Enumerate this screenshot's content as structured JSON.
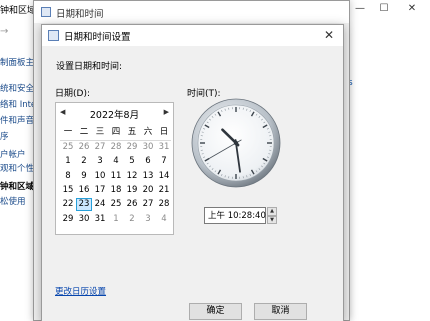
{
  "background": {
    "window_title": "钟和区域",
    "sidebar_items": [
      {
        "label": "制面板主",
        "active": false
      },
      {
        "label": "统和安全",
        "active": false
      },
      {
        "label": "络和 Inte",
        "active": false
      },
      {
        "label": "件和声音",
        "active": false
      },
      {
        "label": "序",
        "active": false
      },
      {
        "label": "户帐户",
        "active": false
      },
      {
        "label": "观和个性",
        "active": false
      },
      {
        "label": "钟和区域",
        "active": true
      },
      {
        "label": "松使用",
        "active": false
      }
    ]
  },
  "outer_dialog": {
    "title": "日期和时间"
  },
  "dialog": {
    "title": "日期和时间设置",
    "heading": "设置日期和时间:",
    "date_label": "日期(D):",
    "time_label": "时间(T):",
    "time_value": "上午 10:28:40",
    "link_label": "更改日历设置",
    "ok_label": "确定",
    "cancel_label": "取消",
    "close_glyph": "✕"
  },
  "calendar": {
    "month_label": "2022年8月",
    "prev_glyph": "◀",
    "next_glyph": "▶",
    "weekdays": [
      "一",
      "二",
      "三",
      "四",
      "五",
      "六",
      "日"
    ],
    "weeks": [
      [
        {
          "d": "25",
          "o": true
        },
        {
          "d": "26",
          "o": true
        },
        {
          "d": "27",
          "o": true
        },
        {
          "d": "28",
          "o": true
        },
        {
          "d": "29",
          "o": true
        },
        {
          "d": "30",
          "o": true
        },
        {
          "d": "31",
          "o": true
        }
      ],
      [
        {
          "d": "1"
        },
        {
          "d": "2"
        },
        {
          "d": "3"
        },
        {
          "d": "4"
        },
        {
          "d": "5"
        },
        {
          "d": "6"
        },
        {
          "d": "7"
        }
      ],
      [
        {
          "d": "8"
        },
        {
          "d": "9"
        },
        {
          "d": "10"
        },
        {
          "d": "11"
        },
        {
          "d": "12"
        },
        {
          "d": "13"
        },
        {
          "d": "14"
        }
      ],
      [
        {
          "d": "15"
        },
        {
          "d": "16"
        },
        {
          "d": "17"
        },
        {
          "d": "18"
        },
        {
          "d": "19"
        },
        {
          "d": "20"
        },
        {
          "d": "21"
        }
      ],
      [
        {
          "d": "22"
        },
        {
          "d": "23",
          "sel": true
        },
        {
          "d": "24"
        },
        {
          "d": "25"
        },
        {
          "d": "26"
        },
        {
          "d": "27"
        },
        {
          "d": "28"
        }
      ],
      [
        {
          "d": "29"
        },
        {
          "d": "30"
        },
        {
          "d": "31"
        },
        {
          "d": "1",
          "o": true
        },
        {
          "d": "2",
          "o": true
        },
        {
          "d": "3",
          "o": true
        },
        {
          "d": "4",
          "o": true
        }
      ]
    ],
    "selected_color": "#26a0da"
  },
  "clock": {
    "hour": 10,
    "minute": 28,
    "second": 40
  }
}
